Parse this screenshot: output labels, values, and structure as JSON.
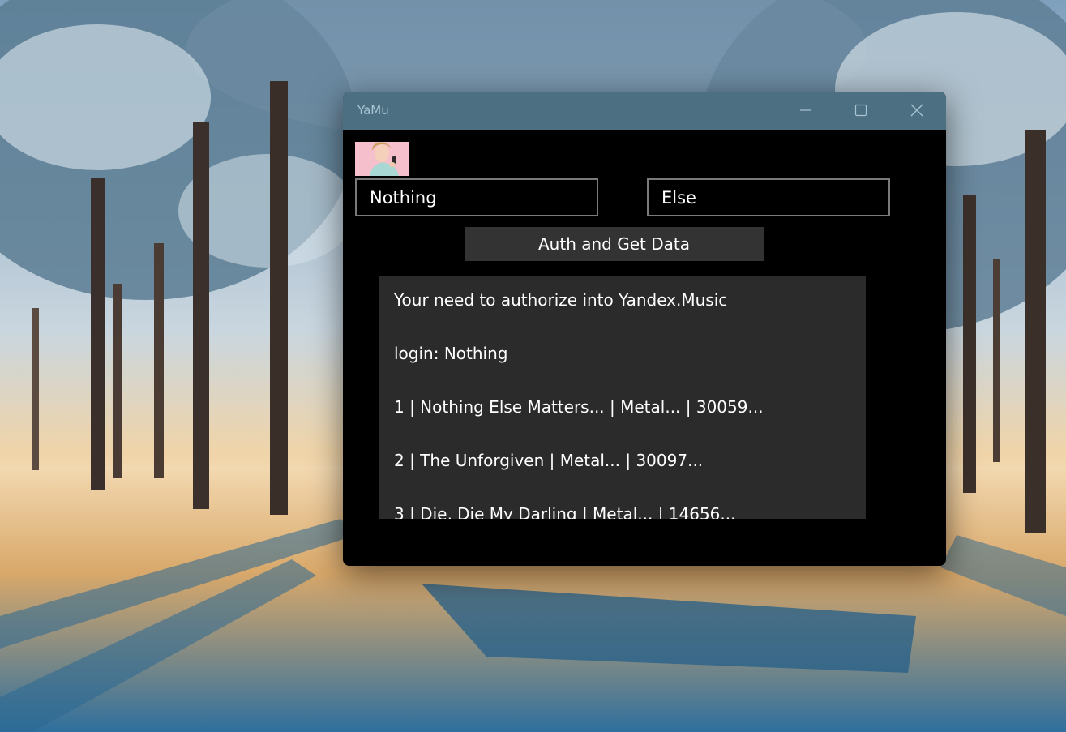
{
  "window": {
    "title": "YaMu",
    "controls": {
      "minimize_icon": "minimize-icon",
      "maximize_icon": "maximize-icon",
      "close_icon": "close-icon"
    }
  },
  "form": {
    "login_value": "Nothing",
    "password_value": "Else",
    "auth_button_label": "Auth and Get Data"
  },
  "output": {
    "lines": [
      "Your need to authorize into Yandex.Music",
      "login: Nothing",
      "1 | Nothing Else Matters... | Metal... | 30059...",
      "2 | The Unforgiven | Metal... | 30097...",
      "3 | Die, Die My Darling | Metal... | 14656..."
    ]
  },
  "colors": {
    "titlebar": "#4c7082",
    "window_background": "#000000",
    "button_background": "#333333",
    "output_background": "#2b2b2b",
    "field_border": "#7a7a7a"
  }
}
